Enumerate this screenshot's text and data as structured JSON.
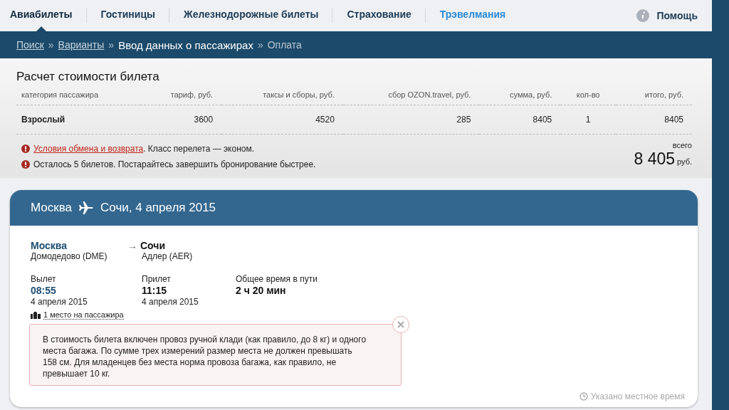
{
  "nav": {
    "items": [
      {
        "label": "Авиабилеты",
        "selected": true,
        "kind": "normal"
      },
      {
        "label": "Гостиницы",
        "selected": false,
        "kind": "normal"
      },
      {
        "label": "Железнодорожные билеты",
        "selected": false,
        "kind": "normal"
      },
      {
        "label": "Страхование",
        "selected": false,
        "kind": "normal"
      },
      {
        "label": "Трэвелмания",
        "selected": false,
        "kind": "highlight"
      }
    ],
    "help": "Помощь"
  },
  "breadcrumb": [
    {
      "label": "Поиск",
      "kind": "link"
    },
    {
      "label": "Варианты",
      "kind": "link"
    },
    {
      "label": "Ввод данных о пассажирах",
      "kind": "current"
    },
    {
      "label": "Оплата",
      "kind": "next"
    }
  ],
  "breadcrumb_separators": [
    "»",
    "»",
    "»"
  ],
  "price": {
    "title": "Расчет стоимости билета",
    "columns": [
      "категория пассажира",
      "тариф, руб.",
      "таксы и сборы, руб.",
      "сбор OZON.travel, руб.",
      "сумма, руб.",
      "кол-во",
      "итого, руб."
    ],
    "rows": [
      [
        "Взрослый",
        "3600",
        "4520",
        "285",
        "8405",
        "1",
        "8405"
      ]
    ],
    "notes": [
      {
        "link": "Условия обмена и возврата",
        "text": ". Класс перелета — эконом."
      },
      {
        "text": "Осталось 5 билетов. Постарайтесь завершить бронирование быстрее."
      }
    ],
    "total_label": "всего",
    "total": "8 405",
    "currency": "руб."
  },
  "flight": {
    "from": "Москва",
    "to_date": "Сочи, 4 апреля 2015",
    "origin": {
      "city": "Москва",
      "airport": "Домодедово (DME)"
    },
    "arrow": "→",
    "destination": {
      "city": "Сочи",
      "airport": "Адлер (AER)"
    },
    "departure": {
      "label": "Вылет",
      "time": "08:55",
      "date": "4 апреля 2015"
    },
    "arrival": {
      "label": "Прилет",
      "time": "11:15",
      "date": "4 апреля 2015"
    },
    "duration": {
      "label": "Общее время в пути",
      "value": "2 ч 20 мин"
    },
    "baggage": "1 место на пассажира",
    "tooltip": "В стоимость билета включен провоз ручной клади (как правило, до 8 кг) и одного места багажа. По сумме трех измерений размер места не должен превышать 158 см. Для младенцев без места норма провоза багажа, как правило, не превышает 10 кг.",
    "local_time": "Указано местное время"
  }
}
